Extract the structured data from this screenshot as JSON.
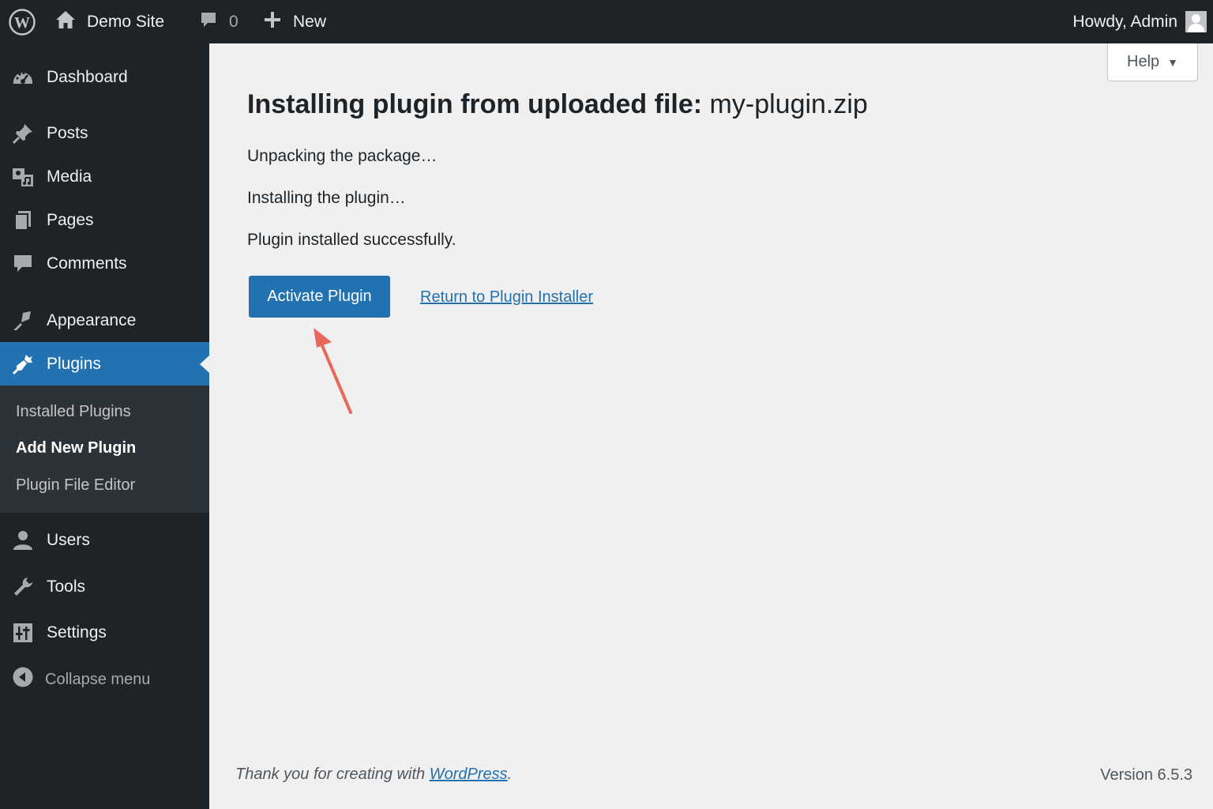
{
  "admin_bar": {
    "site_name": "Demo Site",
    "comments_count": "0",
    "new_label": "New",
    "greeting": "Howdy, Admin"
  },
  "sidebar": {
    "items": [
      {
        "label": "Dashboard",
        "icon": "dashboard-icon"
      },
      {
        "label": "Posts",
        "icon": "pin-icon"
      },
      {
        "label": "Media",
        "icon": "media-icon"
      },
      {
        "label": "Pages",
        "icon": "pages-icon"
      },
      {
        "label": "Comments",
        "icon": "comment-icon"
      },
      {
        "label": "Appearance",
        "icon": "brush-icon"
      },
      {
        "label": "Plugins",
        "icon": "plugin-icon"
      },
      {
        "label": "Users",
        "icon": "user-icon"
      },
      {
        "label": "Tools",
        "icon": "wrench-icon"
      },
      {
        "label": "Settings",
        "icon": "settings-icon"
      }
    ],
    "submenu": [
      "Installed Plugins",
      "Add New Plugin",
      "Plugin File Editor"
    ],
    "collapse_label": "Collapse menu"
  },
  "help": {
    "label": "Help"
  },
  "main": {
    "title_prefix": "Installing plugin from uploaded file:",
    "title_file": "my-plugin.zip",
    "messages": [
      "Unpacking the package…",
      "Installing the plugin…",
      "Plugin installed successfully."
    ],
    "activate_label": "Activate Plugin",
    "return_label": "Return to Plugin Installer"
  },
  "footer": {
    "thanks_prefix": "Thank you for creating with",
    "thanks_link": "WordPress",
    "thanks_suffix": ".",
    "version": "Version 6.5.3"
  },
  "colors": {
    "accent": "#2271b1",
    "sidebar_bg": "#1d2327",
    "submenu_bg": "#2c3338",
    "content_bg": "#f0f0f1",
    "annotation": "#e8665a"
  }
}
